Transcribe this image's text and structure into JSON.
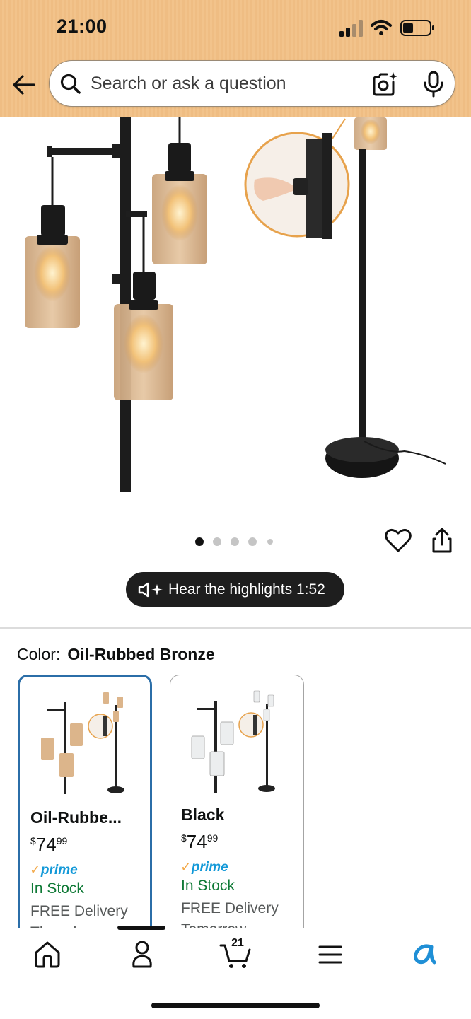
{
  "status_bar": {
    "time": "21:00"
  },
  "search": {
    "placeholder": "Search or ask a question"
  },
  "gallery": {
    "dots_count": 5,
    "active_dot": 0
  },
  "audio": {
    "label": "Hear the highlights 1:52"
  },
  "color_selector": {
    "label": "Color:",
    "selected": "Oil-Rubbed Bronze",
    "options": [
      {
        "name": "Oil-Rubbe...",
        "price_dollars": "74",
        "price_cents": "99",
        "currency": "$",
        "prime": "prime",
        "stock": "In Stock",
        "delivery": "FREE Delivery",
        "extra": "Thursd...",
        "selected": true
      },
      {
        "name": "Black",
        "price_dollars": "74",
        "price_cents": "99",
        "currency": "$",
        "prime": "prime",
        "stock": "In Stock",
        "delivery": "FREE Delivery",
        "extra": "Tomorrow",
        "selected": false
      }
    ]
  },
  "bottom_nav": {
    "cart_count": "21"
  },
  "colors": {
    "prime_blue": "#1399d8",
    "prime_check": "#f3a847",
    "stock_green": "#107a37",
    "selected_border": "#2b6ea8",
    "header_bg": "#efbd83"
  }
}
